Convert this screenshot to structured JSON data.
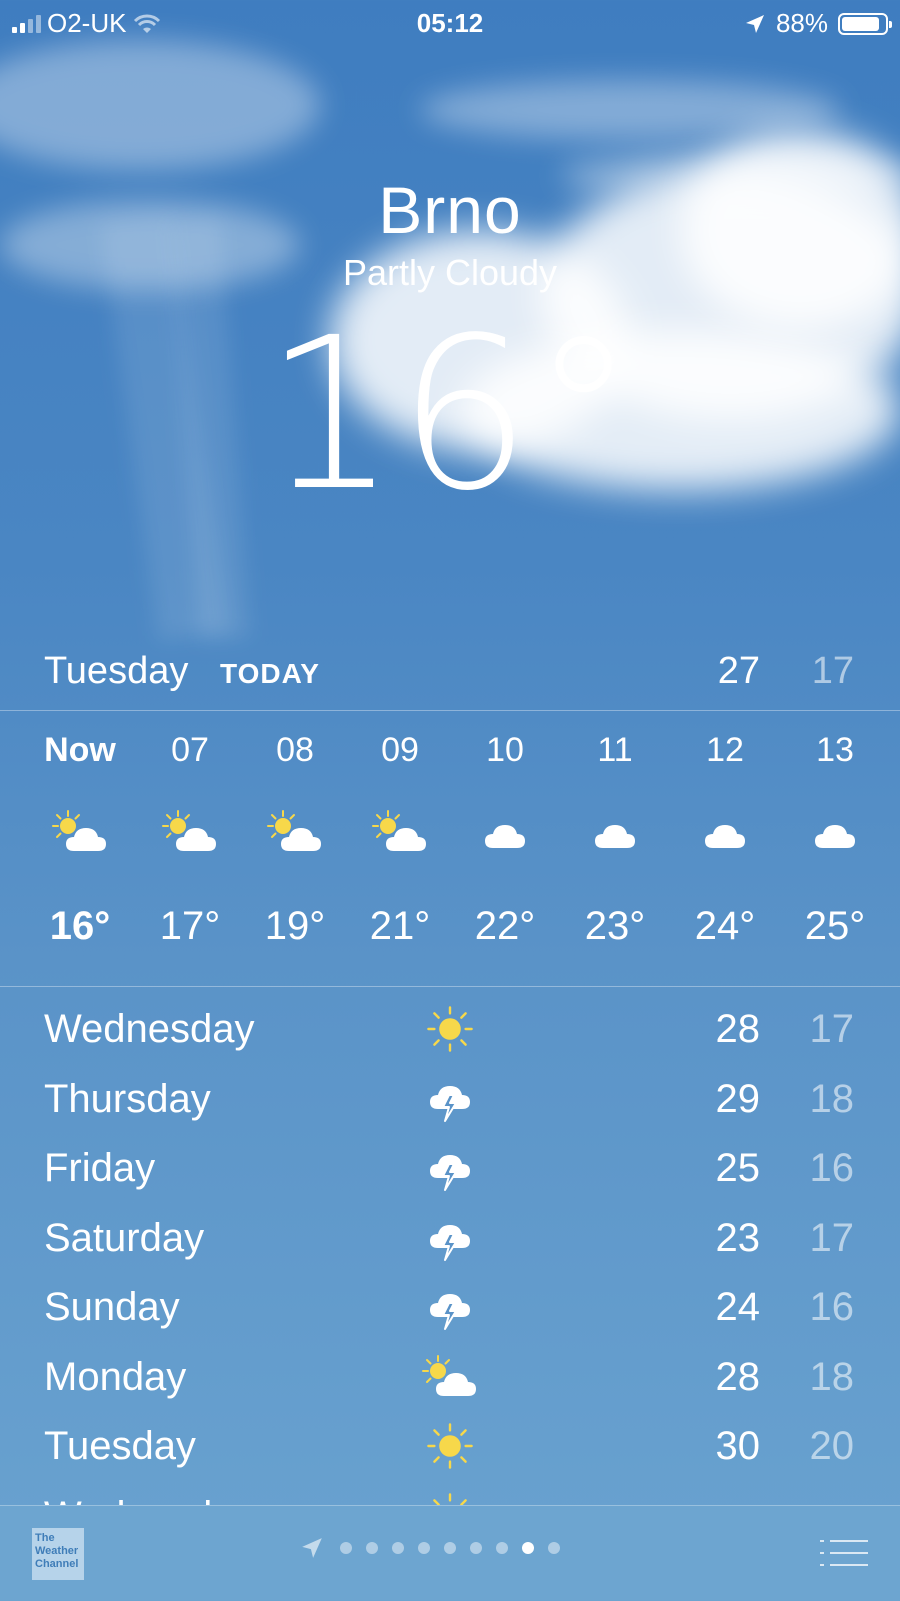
{
  "status_bar": {
    "carrier": "O2-UK",
    "time": "05:12",
    "battery": "88%",
    "battery_level": 0.88,
    "icons": [
      "signal-icon",
      "wifi-icon",
      "location-arrow-icon",
      "battery-icon"
    ]
  },
  "header": {
    "city": "Brno",
    "condition": "Partly Cloudy",
    "temperature": "16°"
  },
  "today": {
    "day": "Tuesday",
    "tag": "TODAY",
    "high": "27",
    "low": "17"
  },
  "hourly": [
    {
      "hour": "Now",
      "icon": "partly-cloudy-icon",
      "temp": "16°"
    },
    {
      "hour": "07",
      "icon": "partly-cloudy-icon",
      "temp": "17°"
    },
    {
      "hour": "08",
      "icon": "partly-cloudy-icon",
      "temp": "19°"
    },
    {
      "hour": "09",
      "icon": "partly-cloudy-icon",
      "temp": "21°"
    },
    {
      "hour": "10",
      "icon": "cloud-icon",
      "temp": "22°"
    },
    {
      "hour": "11",
      "icon": "cloud-icon",
      "temp": "23°"
    },
    {
      "hour": "12",
      "icon": "cloud-icon",
      "temp": "24°"
    },
    {
      "hour": "13",
      "icon": "cloud-icon",
      "temp": "25°"
    }
  ],
  "daily": [
    {
      "day": "Wednesday",
      "icon": "sun-icon",
      "high": "28",
      "low": "17"
    },
    {
      "day": "Thursday",
      "icon": "thunderstorm-icon",
      "high": "29",
      "low": "18"
    },
    {
      "day": "Friday",
      "icon": "thunderstorm-icon",
      "high": "25",
      "low": "16"
    },
    {
      "day": "Saturday",
      "icon": "thunderstorm-icon",
      "high": "23",
      "low": "17"
    },
    {
      "day": "Sunday",
      "icon": "thunderstorm-icon",
      "high": "24",
      "low": "16"
    },
    {
      "day": "Monday",
      "icon": "partly-cloudy-icon",
      "high": "28",
      "low": "18"
    },
    {
      "day": "Tuesday",
      "icon": "sun-icon",
      "high": "30",
      "low": "20"
    },
    {
      "day": "Wednesday",
      "icon": "sun-icon",
      "high": "",
      "low": ""
    }
  ],
  "bottom_bar": {
    "provider_logo_text": "The Weather Channel",
    "page_count": 10,
    "active_page": 9,
    "icons": [
      "weather-channel-logo-icon",
      "location-arrow-icon",
      "list-icon"
    ]
  },
  "colors": {
    "sky": "#4a86c3",
    "sun": "#f7d84a",
    "low_temp": "rgba(255,255,255,0.55)"
  }
}
